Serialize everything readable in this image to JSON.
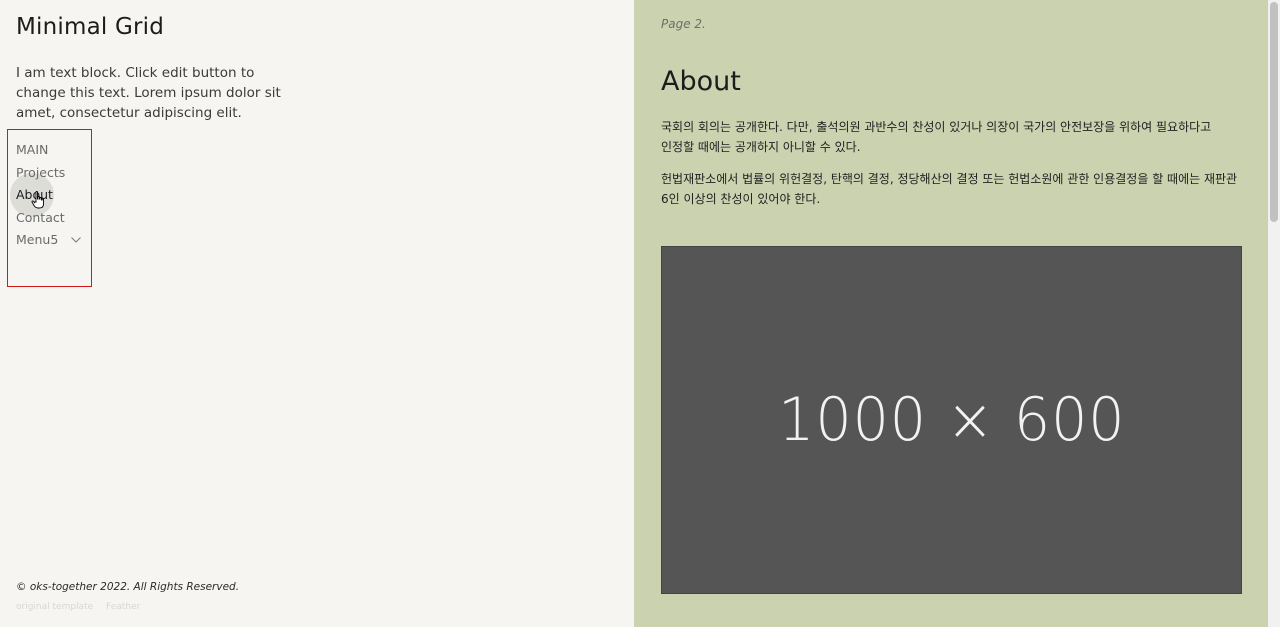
{
  "sidebar": {
    "site_title": "Minimal Grid",
    "intro_text": "I am text block. Click edit button to change this text. Lorem ipsum dolor sit amet, consectetur adipiscing elit.",
    "nav": [
      {
        "label": "MAIN"
      },
      {
        "label": "Projects"
      },
      {
        "label": "About",
        "active": true
      },
      {
        "label": "Contact"
      },
      {
        "label": "Menu5",
        "has_dropdown": true,
        "icon": "chevron-down-icon"
      }
    ],
    "copyright": "© oks-together 2022. All Rights Reserved.",
    "credit": {
      "original": "original template",
      "feather": "Feather"
    }
  },
  "content": {
    "page_label": "Page 2.",
    "title": "About",
    "paragraphs": [
      "국회의 회의는 공개한다. 다만, 출석의원 과반수의 찬성이 있거나 의장이 국가의 안전보장을 위하여 필요하다고 인정할 때에는 공개하지 아니할 수 있다.",
      "헌법재판소에서 법률의 위헌결정, 탄핵의 결정, 정당해산의 결정 또는 헌법소원에 관한 인용결정을 할 때에는 재판관 6인 이상의 찬성이 있어야 한다."
    ],
    "image_placeholder": "1000 × 600"
  },
  "colors": {
    "left_bg": "#f6f5f1",
    "right_bg": "#cbd2b0",
    "highlight_border": "#d11919",
    "placeholder_bg": "#555555"
  }
}
